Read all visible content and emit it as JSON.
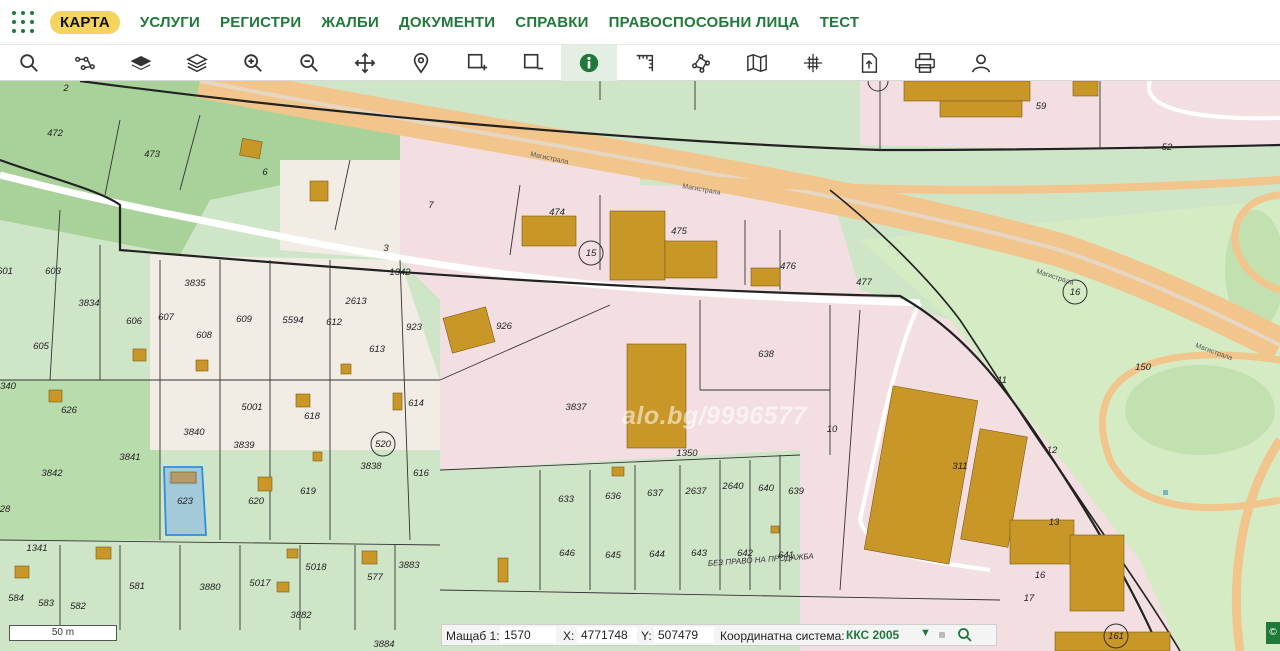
{
  "nav": {
    "items": [
      {
        "label": "КАРТА",
        "active": true
      },
      {
        "label": "УСЛУГИ"
      },
      {
        "label": "РЕГИСТРИ"
      },
      {
        "label": "ЖАЛБИ"
      },
      {
        "label": "ДОКУМЕНТИ"
      },
      {
        "label": "СПРАВКИ"
      },
      {
        "label": "ПРАВОСПОСОБНИ ЛИЦА"
      },
      {
        "label": "ТЕСТ"
      }
    ]
  },
  "toolbar": {
    "tools": [
      "search-icon",
      "network-icon",
      "layer-icon",
      "layers-icon",
      "zoom-in-icon",
      "zoom-out-icon",
      "pan-icon",
      "location-pin-icon",
      "add-rectangle-icon",
      "remove-rectangle-icon",
      "info-icon",
      "measure-icon",
      "nodes-icon",
      "map-icon",
      "crosshair-icon",
      "export-icon",
      "print-icon",
      "user-icon"
    ],
    "active": "info-icon"
  },
  "map": {
    "parcel_labels": [
      "2",
      "472",
      "473",
      "6",
      "7",
      "474",
      "475",
      "15",
      "476",
      "477",
      "3",
      "1342",
      "3835",
      "607",
      "608",
      "609",
      "5594",
      "612",
      "2613",
      "613",
      "923",
      "926",
      "603",
      "601",
      "3834",
      "606",
      "605",
      "340",
      "626",
      "3840",
      "5001",
      "618",
      "614",
      "3839",
      "520",
      "3842",
      "3841",
      "3838",
      "616",
      "623",
      "620",
      "619",
      "28",
      "1341",
      "581",
      "3880",
      "5017",
      "5018",
      "577",
      "3883",
      "584",
      "583",
      "582",
      "3882",
      "3884",
      "638",
      "3837",
      "1350",
      "633",
      "636",
      "637",
      "2637",
      "2640",
      "640",
      "639",
      "646",
      "645",
      "644",
      "643",
      "642",
      "641",
      "10",
      "311",
      "13",
      "16",
      "17",
      "161",
      "11",
      "12",
      "150",
      "16",
      "59",
      "52"
    ],
    "road_labels": [
      "Магистрала",
      "Магистрала",
      "Магистрала",
      "Магистрала"
    ],
    "notice": "БЕЗ ПРАВО НА ПРОДАЖБА",
    "watermark": "alo.bg/9996577",
    "colors": {
      "urban": "#f3dfe1",
      "agri": "#cfe5c8",
      "forest": "#a9d29a",
      "building": "#c99728",
      "road": "#f2c58c",
      "selected": "#9cc5dd"
    }
  },
  "scale": {
    "label": "50 m"
  },
  "coords": {
    "scale_label": "Мащаб 1:",
    "scale_value": "1570",
    "x_label": "X:",
    "x_value": "4771748",
    "y_label": "Y:",
    "y_value": "507479",
    "crs_label": "Координатна система:",
    "crs_value": "ККС 2005"
  },
  "corner": {
    "label": "©"
  }
}
